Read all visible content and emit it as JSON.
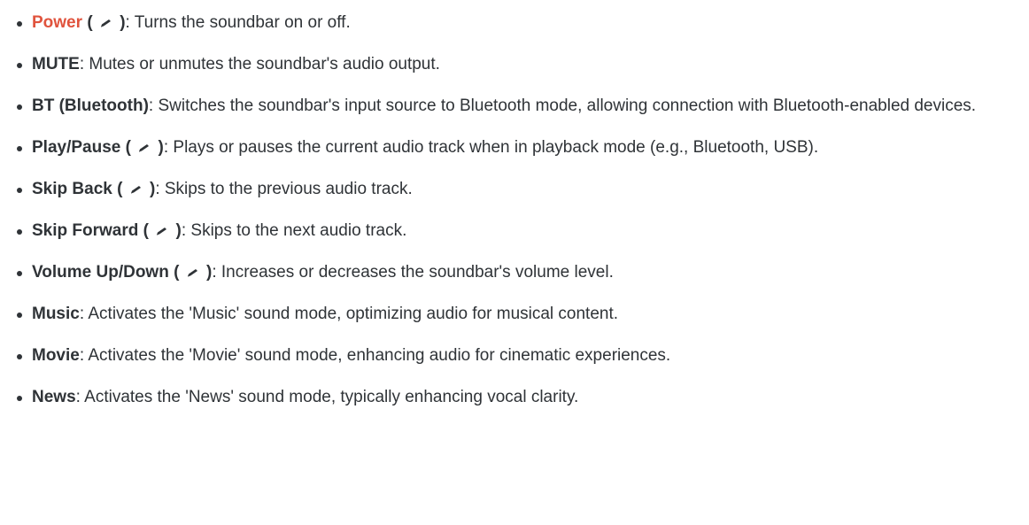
{
  "items": [
    {
      "term": "Power",
      "is_link": true,
      "has_icon": true,
      "desc": ": Turns the soundbar on or off."
    },
    {
      "term": "MUTE",
      "is_link": false,
      "has_icon": false,
      "desc": ": Mutes or unmutes the soundbar's audio output."
    },
    {
      "term": "BT (Bluetooth)",
      "is_link": false,
      "has_icon": false,
      "desc": ": Switches the soundbar's input source to Bluetooth mode, allowing connection with Bluetooth-enabled devices."
    },
    {
      "term": "Play/Pause",
      "is_link": false,
      "has_icon": true,
      "desc": ": Plays or pauses the current audio track when in playback mode (e.g., Bluetooth, USB)."
    },
    {
      "term": "Skip Back",
      "is_link": false,
      "has_icon": true,
      "desc": ": Skips to the previous audio track."
    },
    {
      "term": "Skip Forward",
      "is_link": false,
      "has_icon": true,
      "desc": ": Skips to the next audio track."
    },
    {
      "term": "Volume Up/Down",
      "is_link": false,
      "has_icon": true,
      "desc": ": Increases or decreases the soundbar's volume level."
    },
    {
      "term": "Music",
      "is_link": false,
      "has_icon": false,
      "desc": ": Activates the 'Music' sound mode, optimizing audio for musical content."
    },
    {
      "term": "Movie",
      "is_link": false,
      "has_icon": false,
      "desc": ": Activates the 'Movie' sound mode, enhancing audio for cinematic experiences."
    },
    {
      "term": "News",
      "is_link": false,
      "has_icon": false,
      "desc": ": Activates the 'News' sound mode, typically enhancing vocal clarity."
    }
  ],
  "icon": {
    "name": "pencil-icon",
    "paren_open": "(",
    "paren_close": ")"
  },
  "colors": {
    "text": "#2f3337",
    "link": "#e0533d"
  }
}
